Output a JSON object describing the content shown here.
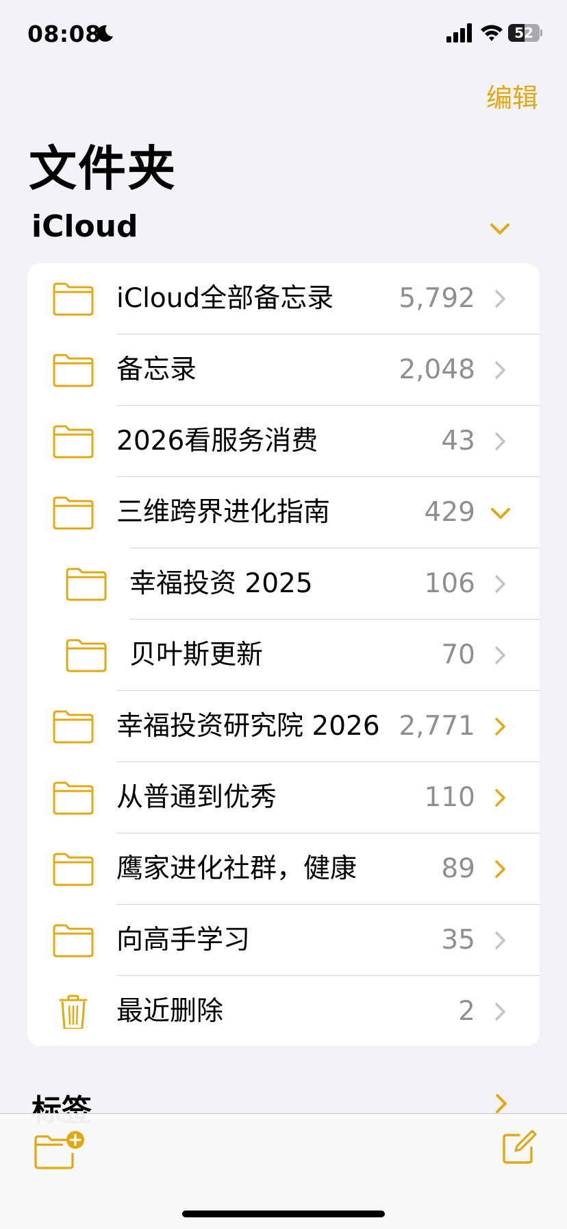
{
  "status_bar": {
    "time": "08:08",
    "battery": "52",
    "battery_level": 0.52,
    "icons": [
      "moon-icon",
      "cellular-signal-icon",
      "wifi-icon",
      "battery-icon"
    ]
  },
  "header": {
    "edit_label": "编辑",
    "title": "文件夹"
  },
  "icloud_section": {
    "title": "iCloud",
    "expanded": true,
    "folders": [
      {
        "label": "iCloud全部备忘录",
        "count": "5,792",
        "icon": "folder-icon",
        "chevron": "chevron-right-icon",
        "chevron_color": "#C4C4C7",
        "indent": 0
      },
      {
        "label": "备忘录",
        "count": "2,048",
        "icon": "folder-icon",
        "chevron": "chevron-right-icon",
        "chevron_color": "#C4C4C7",
        "indent": 0
      },
      {
        "label": "2026看服务消费",
        "count": "43",
        "icon": "folder-icon",
        "chevron": "chevron-right-icon",
        "chevron_color": "#C4C4C7",
        "indent": 0
      },
      {
        "label": "三维跨界进化指南",
        "count": "429",
        "icon": "folder-icon",
        "chevron": "chevron-down-icon",
        "chevron_color": "#E2A811",
        "indent": 0
      },
      {
        "label": "幸福投资 2025",
        "count": "106",
        "icon": "folder-icon",
        "chevron": "chevron-right-icon",
        "chevron_color": "#C4C4C7",
        "indent": 1
      },
      {
        "label": "贝叶斯更新",
        "count": "70",
        "icon": "folder-icon",
        "chevron": "chevron-right-icon",
        "chevron_color": "#C4C4C7",
        "indent": 1
      },
      {
        "label": "幸福投资研究院 2026",
        "count": "2,771",
        "icon": "folder-icon",
        "chevron": "chevron-right-icon",
        "chevron_color": "#E2A811",
        "indent": 0
      },
      {
        "label": "从普通到优秀",
        "count": "110",
        "icon": "folder-icon",
        "chevron": "chevron-right-icon",
        "chevron_color": "#E2A811",
        "indent": 0
      },
      {
        "label": "鹰家进化社群，健康",
        "count": "89",
        "icon": "folder-icon",
        "chevron": "chevron-right-icon",
        "chevron_color": "#E2A811",
        "indent": 0
      },
      {
        "label": "向高手学习",
        "count": "35",
        "icon": "folder-icon",
        "chevron": "chevron-right-icon",
        "chevron_color": "#C4C4C7",
        "indent": 0
      },
      {
        "label": "最近删除",
        "count": "2",
        "icon": "trash-icon",
        "chevron": "chevron-right-icon",
        "chevron_color": "#C4C4C7",
        "indent": 0
      }
    ]
  },
  "tags_section": {
    "title": "标签"
  },
  "toolbar": {
    "left_icon": "new-folder-icon",
    "right_icon": "compose-icon"
  },
  "colors": {
    "accent": "#E2A811",
    "background": "#F2F2F7",
    "card": "#FFFFFF",
    "secondary_text": "#8E8E93",
    "chevron_gray": "#C4C4C7",
    "separator": "#D1D1D6"
  }
}
